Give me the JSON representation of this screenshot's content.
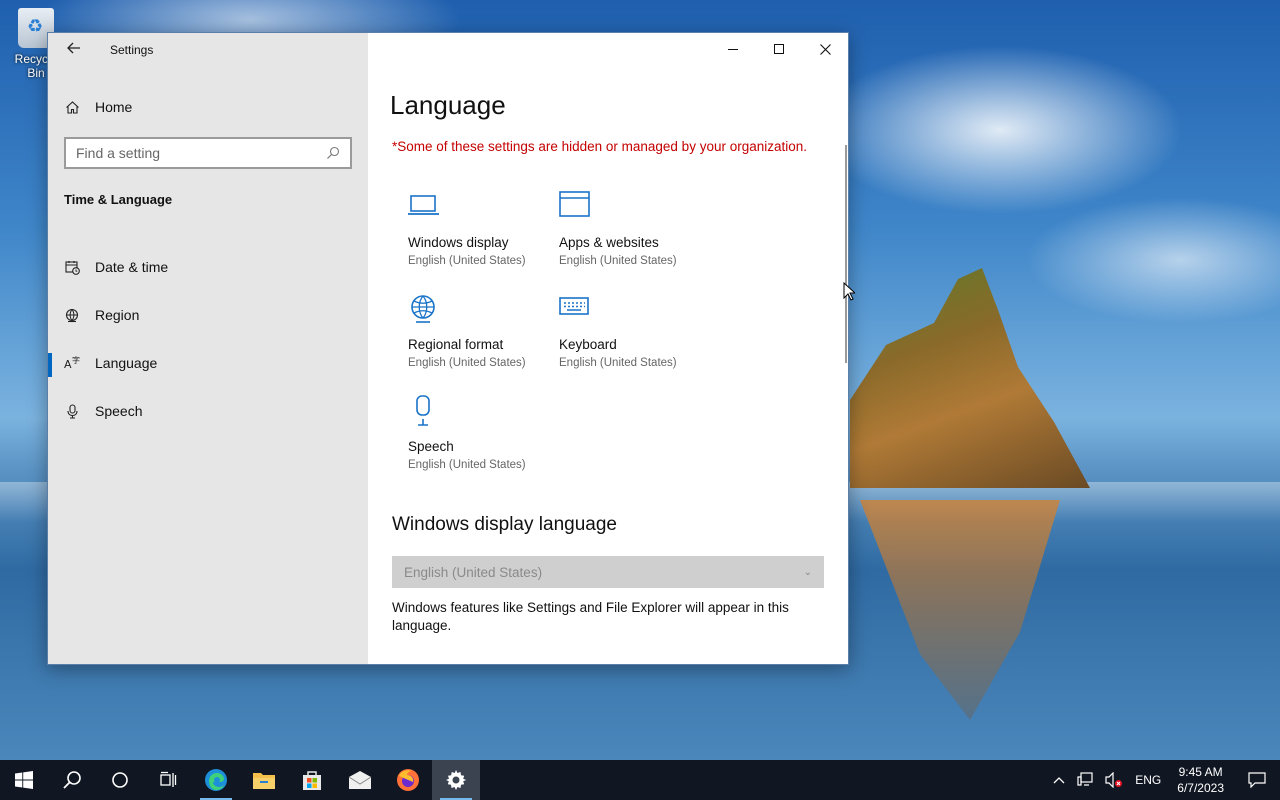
{
  "desktop": {
    "recycle_bin_label": "Recycle Bin"
  },
  "window": {
    "title": "Settings",
    "controls": {
      "minimize": "minimize",
      "maximize": "maximize",
      "close": "close"
    }
  },
  "sidebar": {
    "home_label": "Home",
    "search_placeholder": "Find a setting",
    "section_title": "Time & Language",
    "items": [
      {
        "label": "Date & time",
        "icon": "calendar-clock-icon",
        "active": false
      },
      {
        "label": "Region",
        "icon": "globe-icon",
        "active": false
      },
      {
        "label": "Language",
        "icon": "language-icon",
        "active": true
      },
      {
        "label": "Speech",
        "icon": "microphone-icon",
        "active": false
      }
    ]
  },
  "main": {
    "title": "Language",
    "warning": "*Some of these settings are hidden or managed by your organization.",
    "tiles": [
      {
        "name": "Windows display",
        "sub": "English (United States)",
        "icon": "laptop-icon"
      },
      {
        "name": "Apps & websites",
        "sub": "English (United States)",
        "icon": "window-icon"
      },
      {
        "name": "Regional format",
        "sub": "English (United States)",
        "icon": "globe-icon"
      },
      {
        "name": "Keyboard",
        "sub": "English (United States)",
        "icon": "keyboard-icon"
      },
      {
        "name": "Speech",
        "sub": "English (United States)",
        "icon": "microphone-icon"
      }
    ],
    "display_language_heading": "Windows display language",
    "display_language_value": "English (United States)",
    "display_language_desc": "Windows features like Settings and File Explorer will appear in this language."
  },
  "taskbar": {
    "tray_language": "ENG",
    "time": "9:45 AM",
    "date": "6/7/2023"
  },
  "colors": {
    "accent": "#0067c0",
    "warning": "#c40000",
    "icon_blue": "#1a73c8"
  }
}
